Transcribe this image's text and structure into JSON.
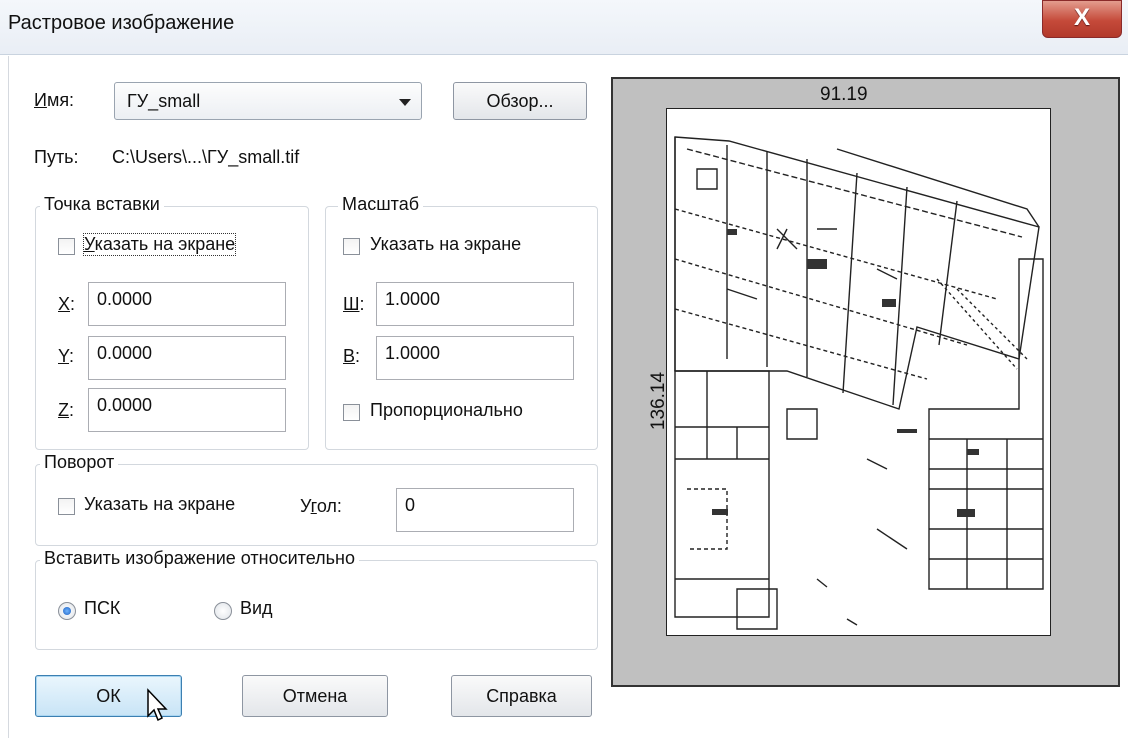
{
  "window": {
    "title": "Растровое изображение",
    "close_label": "X"
  },
  "name_row": {
    "label_u": "И",
    "label_rest": "мя:",
    "value": "ГУ_small",
    "browse_label": "Обзор..."
  },
  "path_row": {
    "label": "Путь:",
    "value": "C:\\Users\\...\\ГУ_small.tif"
  },
  "insert_point": {
    "title": "Точка вставки",
    "specify_u": "У",
    "specify_rest": "казать на экране",
    "x_u": "X",
    "x_rest": ":",
    "x_value": "0.0000",
    "y_u": "Y",
    "y_rest": ":",
    "y_value": "0.0000",
    "z_u": "Z",
    "z_rest": ":",
    "z_value": "0.0000"
  },
  "scale": {
    "title": "Масштаб",
    "specify": "Указать на экране",
    "w_u": "Ш",
    "w_rest": ":",
    "w_value": "1.0000",
    "h_u": "В",
    "h_rest": ":",
    "h_value": "1.0000",
    "proportional": "Пропорционально"
  },
  "rotation": {
    "title": "Поворот",
    "specify": "Указать на экране",
    "angle_pre": "У",
    "angle_u": "г",
    "angle_rest": "ол:",
    "angle_value": "0"
  },
  "relative": {
    "title": "Вставить изображение относительно",
    "option_ucs": "ПСК",
    "option_view": "Вид",
    "selected": "ПСК"
  },
  "buttons": {
    "ok": "ОК",
    "cancel": "Отмена",
    "help": "Справка"
  },
  "preview": {
    "width_label": "91.19",
    "height_label": "136.14"
  }
}
